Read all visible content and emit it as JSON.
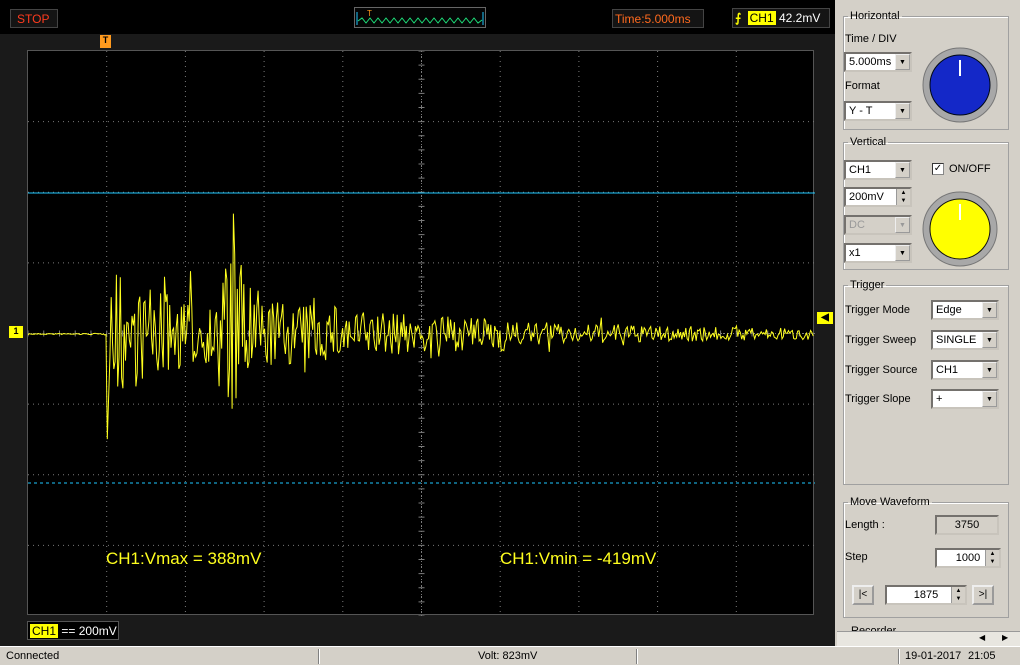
{
  "topbar": {
    "state": "STOP",
    "trigger_window_mark": "T",
    "time": "Time:5.000ms",
    "trigger_channel": "CH1",
    "trigger_level": "42.2mV"
  },
  "screen": {
    "trigger_position_marker": "T",
    "channel_marker": "1",
    "vmax_label": "CH1:Vmax = 388mV",
    "vmin_label": "CH1:Vmin = -419mV",
    "channel_badge": "CH1",
    "channel_coupling_symbol": "==",
    "channel_scale": "200mV",
    "colors": {
      "trace": "#ffff1e",
      "grid": "#7a7a7a",
      "cursor_max": "#1ec8ff",
      "cursor_min": "#1ec8ff"
    }
  },
  "horizontal": {
    "title": "Horizontal",
    "time_div_label": "Time / DIV",
    "time_div_value": "5.000ms",
    "format_label": "Format",
    "format_value": "Y - T"
  },
  "vertical": {
    "title": "Vertical",
    "channel_value": "CH1",
    "onoff_label": "ON/OFF",
    "volts_value": "200mV",
    "coupling_value": "DC",
    "probe_value": "x1"
  },
  "trigger": {
    "title": "Trigger",
    "mode_label": "Trigger Mode",
    "mode_value": "Edge",
    "sweep_label": "Trigger Sweep",
    "sweep_value": "SINGLE",
    "source_label": "Trigger Source",
    "source_value": "CH1",
    "slope_label": "Trigger Slope",
    "slope_value": "+"
  },
  "move_waveform": {
    "title": "Move Waveform",
    "length_label": "Length :",
    "length_value": "3750",
    "step_label": "Step",
    "step_value": "1000",
    "prev_label": "|<",
    "position_value": "1875",
    "next_label": ">|"
  },
  "next_group_title": "Recorder",
  "status": {
    "connection": "Connected",
    "volt": "Volt: 823mV",
    "date": "19-01-2017",
    "clock": "21:05"
  }
}
